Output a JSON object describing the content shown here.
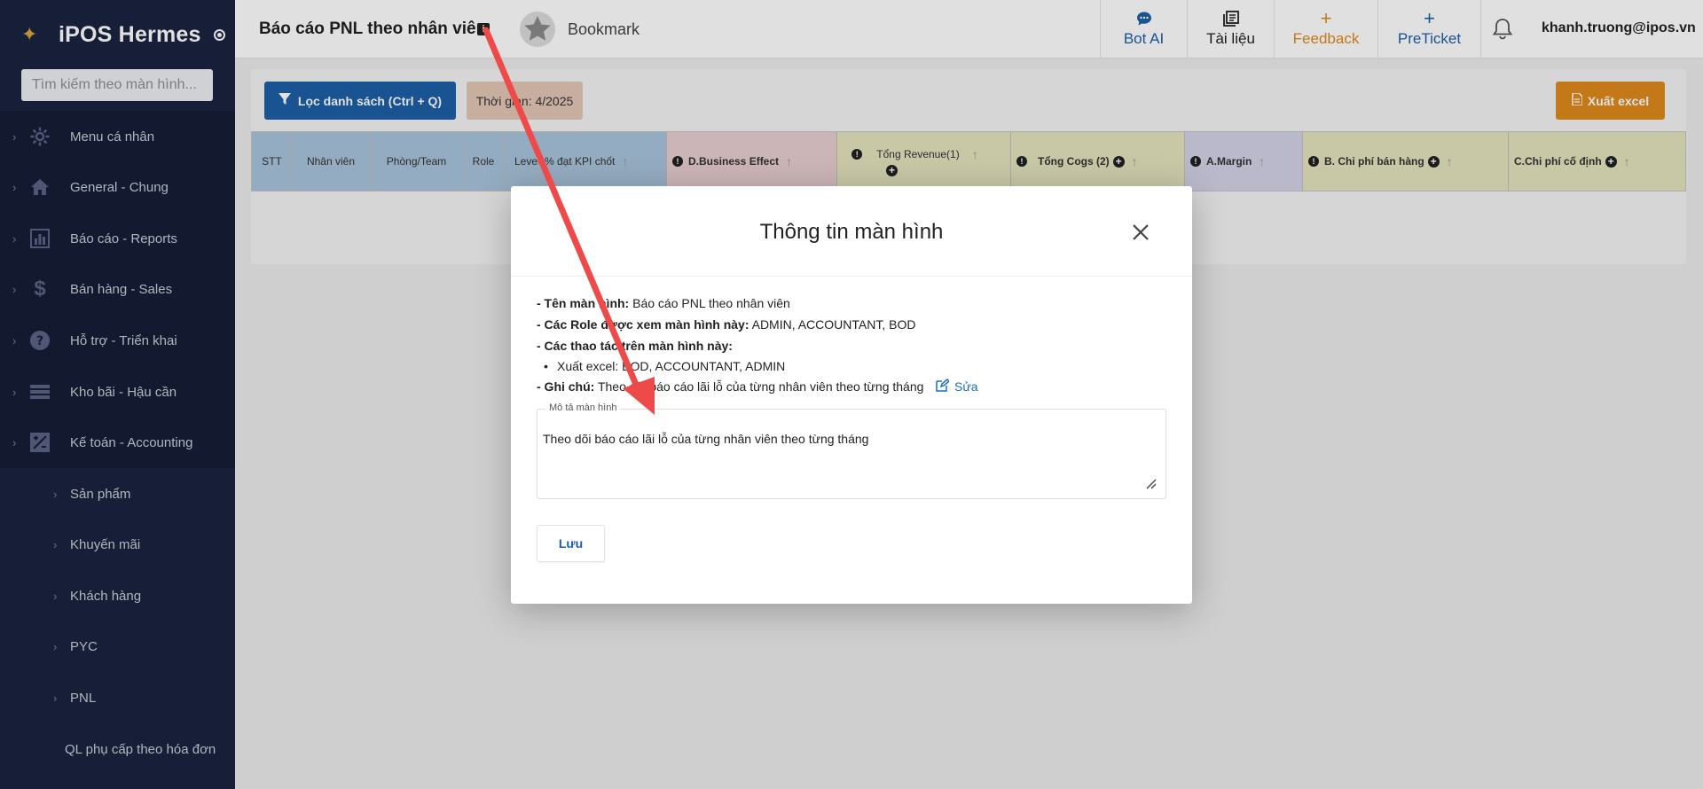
{
  "sidebar": {
    "brand": "iPOS Hermes",
    "search_placeholder": "Tìm kiếm theo màn hình...",
    "items": [
      {
        "label": "Menu cá nhân",
        "icon": "gear-icon"
      },
      {
        "label": "General - Chung",
        "icon": "home-icon"
      },
      {
        "label": "Báo cáo - Reports",
        "icon": "chart-icon"
      },
      {
        "label": "Bán hàng - Sales",
        "icon": "dollar-icon"
      },
      {
        "label": "Hỗ trợ - Triển khai",
        "icon": "help-icon"
      },
      {
        "label": "Kho bãi - Hậu cần",
        "icon": "list-icon"
      },
      {
        "label": "Kế toán - Accounting",
        "icon": "calculator-icon"
      }
    ],
    "sub_items": [
      "Sản phẩm",
      "Khuyến mãi",
      "Khách hàng",
      "PYC",
      "PNL"
    ],
    "plain_item": "QL phụ cấp theo hóa đơn"
  },
  "header": {
    "title": "Báo cáo PNL theo nhân viên",
    "info_badge": "i",
    "bookmark": "Bookmark",
    "buttons": [
      {
        "label": "Bot AI",
        "icon": "chat-icon",
        "symbol": "💬",
        "color": "#1d5fa7"
      },
      {
        "label": "Tài liệu",
        "icon": "document-icon",
        "symbol": "▤",
        "color": "#222222"
      },
      {
        "label": "Feedback",
        "icon": "plus-icon",
        "symbol": "+",
        "color": "#e08a1c"
      },
      {
        "label": "PreTicket",
        "icon": "plus-icon",
        "symbol": "+",
        "color": "#1d5fa7"
      }
    ],
    "user": "khanh.truong@ipos.vn"
  },
  "toolbar": {
    "filter_label": "Lọc danh sách (Ctrl + Q)",
    "time_label": "Thời gian: 4/2025",
    "excel_label": "Xuất excel"
  },
  "table": {
    "columns": [
      {
        "label": "STT",
        "bg": "#a9c4dc"
      },
      {
        "label": "Nhân viên",
        "bg": "#a9c4dc"
      },
      {
        "label": "Phòng/Team",
        "bg": "#a9c4dc"
      },
      {
        "label": "Role",
        "bg": "#a9c4dc"
      },
      {
        "label": "Level",
        "bg": "#a9c4dc"
      },
      {
        "label": "% đạt KPI chốt",
        "bg": "#a9c4dc"
      },
      {
        "label": "D.Business Effect",
        "bg": "#e8cfd0"
      },
      {
        "label": "Tổng Revenue(1)",
        "bg": "#e4e3bd"
      },
      {
        "label": "Tổng Cogs (2)",
        "bg": "#e4e3bd"
      },
      {
        "label": "A.Margin",
        "bg": "#d3d3e8"
      },
      {
        "label": "B. Chi phí bán hàng",
        "bg": "#e4e3bd"
      },
      {
        "label": "C.Chi phí cố định",
        "bg": "#e4e3bd"
      }
    ]
  },
  "modal": {
    "title": "Thông tin màn hình",
    "name_label": "- Tên màn hình:",
    "name_value": " Báo cáo PNL theo nhân viên",
    "roles_label": "- Các Role được xem màn hình này:",
    "roles_value": " ADMIN, ACCOUNTANT, BOD",
    "actions_label": "- Các thao tác trên màn hình này:",
    "action_item": "Xuất excel: BOD, ACCOUNTANT, ADMIN",
    "note_label": "- Ghi chú:",
    "note_value": " Theo dõi báo cáo lãi lỗ của từng nhân viên theo từng tháng",
    "edit_label": "Sửa",
    "desc_legend": "Mô tả màn hình",
    "desc_value": "Theo dõi báo cáo lãi lỗ của từng nhân viên theo từng tháng",
    "save_label": "Lưu"
  },
  "colors": {
    "sidebar_bg": "#1b2440",
    "primary": "#1d5fa7",
    "excel": "#e08a1c",
    "annotation_arrow": "#ef4a4a"
  }
}
